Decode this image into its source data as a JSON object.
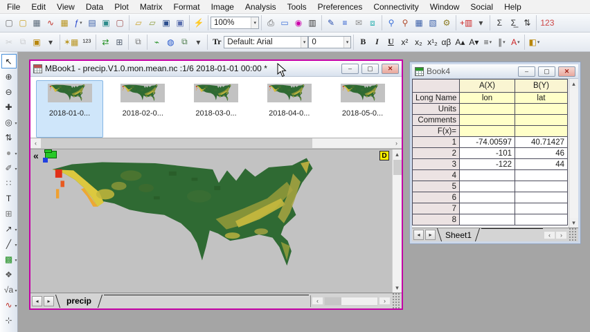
{
  "menu": {
    "items": [
      "File",
      "Edit",
      "View",
      "Data",
      "Plot",
      "Matrix",
      "Format",
      "Image",
      "Analysis",
      "Tools",
      "Preferences",
      "Connectivity",
      "Window",
      "Social",
      "Help"
    ]
  },
  "glyphs": {
    "min": "‒",
    "restore": "▢",
    "close": "✕",
    "left": "◂",
    "right": "▸",
    "sleft": "‹",
    "sright": "›",
    "up": "▴",
    "down": "▾"
  },
  "tb1": {
    "g1": [
      {
        "n": "new-project-button",
        "g": "▢",
        "c": "#6a6a6a"
      },
      {
        "n": "new-folder-button",
        "g": "▢",
        "c": "#c9a227"
      },
      {
        "n": "new-workbook-button",
        "g": "▦",
        "c": "#5a6a7a"
      },
      {
        "n": "new-graph-button",
        "g": "∿",
        "c": "#c03028"
      },
      {
        "n": "new-matrix-button",
        "g": "▦",
        "c": "#b8941f"
      },
      {
        "n": "new-function-button",
        "g": "ƒ",
        "c": "#2244cc",
        "dd": 1
      },
      {
        "n": "new-report-button",
        "g": "▤",
        "c": "#3a5fa8"
      },
      {
        "n": "new-layout-button",
        "g": "▣",
        "c": "#2e8b8b"
      },
      {
        "n": "new-notes-button",
        "g": "▢",
        "c": "#a05050"
      }
    ],
    "g2": [
      {
        "n": "open-button",
        "g": "▱",
        "c": "#c9a227"
      },
      {
        "n": "open-template-button",
        "g": "▱",
        "c": "#8a9a3a"
      },
      {
        "n": "save-project-button",
        "g": "▣",
        "c": "#2d4f8e"
      },
      {
        "n": "save-template-button",
        "g": "▣",
        "c": "#5a6fae"
      }
    ],
    "g3": [
      {
        "n": "import-wizard-run-button",
        "g": "⚡",
        "c": "#1e9e1e"
      }
    ],
    "zoom": {
      "value": "100%"
    },
    "g5": [
      {
        "n": "print-button",
        "g": "⎙",
        "c": "#555555"
      },
      {
        "n": "slide-view-button",
        "g": "▭",
        "c": "#3a6fd8"
      },
      {
        "n": "active-frame-button",
        "g": "◉",
        "c": "#cc00aa"
      },
      {
        "n": "video-button",
        "g": "▥",
        "c": "#333333"
      }
    ],
    "g6": [
      {
        "n": "edit-page-button",
        "g": "✎",
        "c": "#2a4fae"
      },
      {
        "n": "arrange-layers-button",
        "g": "≡",
        "c": "#2255cc"
      },
      {
        "n": "send-graph-button",
        "g": "✉",
        "c": "#8a8a8a"
      },
      {
        "n": "project-explorer-button",
        "g": "⧈",
        "c": "#2ab0b0"
      }
    ],
    "g7": [
      {
        "n": "zoom-window-button",
        "g": "⚲",
        "c": "#3a6fd8"
      },
      {
        "n": "find-button",
        "g": "⚲",
        "c": "#b04a2a"
      },
      {
        "n": "worksheet-view-button",
        "g": "▦",
        "c": "#3a5fa8"
      },
      {
        "n": "format-worksheet-button",
        "g": "▧",
        "c": "#3a5fa8"
      },
      {
        "n": "options-button",
        "g": "⚙",
        "c": "#8a7a20"
      }
    ],
    "g8": [
      {
        "n": "add-column-button",
        "g": "+▥",
        "c": "#cc2222"
      },
      {
        "n": "toolbar-overflow-button",
        "g": "▾",
        "c": "#444444"
      }
    ],
    "g9": [
      {
        "n": "sum-column-button",
        "g": "Σ",
        "c": "#333333"
      },
      {
        "n": "statistics-button",
        "g": "Σ̲",
        "c": "#333333"
      },
      {
        "n": "sort-button",
        "g": "⇅",
        "c": "#333333"
      }
    ],
    "g10": [
      {
        "n": "set-values-button",
        "g": "123",
        "c": "#cc4444"
      }
    ]
  },
  "tb2": {
    "h1": [
      {
        "n": "cut-button",
        "g": "✂",
        "c": "#999999",
        "dim": 1
      },
      {
        "n": "copy-button",
        "g": "⧉",
        "c": "#999999",
        "dim": 1
      },
      {
        "n": "paste-button",
        "g": "▣",
        "c": "#b8860b"
      },
      {
        "n": "clipboard-overflow-button",
        "g": "▾",
        "c": "#444444"
      }
    ],
    "h2": [
      {
        "n": "import-wizard-button",
        "g": "✶▦",
        "c": "#b8941f"
      },
      {
        "n": "import-ascii-button",
        "g": "¹²³",
        "c": "#333333"
      }
    ],
    "h3": [
      {
        "n": "reimport-button",
        "g": "⇄",
        "c": "#1e8e1e"
      },
      {
        "n": "reimport-direct-button",
        "g": "⊞",
        "c": "#556070"
      }
    ],
    "h4": [
      {
        "n": "clone-import-button",
        "g": "⧉",
        "c": "#777777"
      }
    ],
    "h5": [
      {
        "n": "data-connector-button",
        "g": "⌁",
        "c": "#1e8e1e"
      },
      {
        "n": "web-connector-button",
        "g": "◍",
        "c": "#2255cc"
      },
      {
        "n": "connector-clone-button",
        "g": "⧉",
        "c": "#4a7a4a"
      },
      {
        "n": "import-overflow-button",
        "g": "▾",
        "c": "#444444"
      }
    ],
    "font": {
      "tr_label": "Tr",
      "family": "Default: Arial",
      "size": "0"
    },
    "h7": [
      {
        "n": "bold-button",
        "g": "B",
        "c": "#222222"
      },
      {
        "n": "italic-button",
        "g": "I",
        "c": "#222222"
      },
      {
        "n": "underline-button",
        "g": "U",
        "c": "#222222"
      },
      {
        "n": "superscript-button",
        "g": "x²",
        "c": "#222222"
      },
      {
        "n": "subscript-button",
        "g": "x₂",
        "c": "#222222"
      },
      {
        "n": "supersubscript-button",
        "g": "x¹₂",
        "c": "#222222"
      },
      {
        "n": "greek-button",
        "g": "αβ",
        "c": "#222222"
      },
      {
        "n": "increase-font-button",
        "g": "A▴",
        "c": "#222222"
      },
      {
        "n": "decrease-font-button",
        "g": "A▾",
        "c": "#222222"
      },
      {
        "n": "align-button",
        "g": "≡",
        "c": "#444444",
        "dd": 1
      },
      {
        "n": "distribute-button",
        "g": "∥",
        "c": "#444444",
        "dd": 1
      },
      {
        "n": "font-color-button",
        "g": "A",
        "c": "#cc2222",
        "dd": 1
      }
    ],
    "h8": [
      {
        "n": "fill-color-button",
        "g": "◧",
        "c": "#b8860b",
        "dd": 1
      }
    ]
  },
  "sidebar": {
    "tools": [
      {
        "n": "pointer-tool",
        "g": "↖",
        "c": "#111111",
        "sel": 1
      },
      {
        "n": "zoom-in-tool",
        "g": "⊕",
        "c": "#333333"
      },
      {
        "n": "zoom-out-tool",
        "g": "⊖",
        "c": "#333333"
      },
      {
        "n": "screen-reader-tool",
        "g": "✚",
        "c": "#333333"
      },
      {
        "n": "data-reader-tool",
        "g": "◎",
        "c": "#333333",
        "dd": 1
      },
      {
        "n": "data-selector-tool",
        "g": "⇅",
        "c": "#333333"
      },
      {
        "n": "mask-tool",
        "g": "●",
        "c": "#999999",
        "dd": 1
      },
      {
        "n": "draw-data-tool",
        "g": "✐",
        "c": "#555555",
        "dd": 1
      },
      {
        "n": "regional-select-tool",
        "g": "∷",
        "c": "#666666"
      },
      {
        "n": "text-tool",
        "g": "T",
        "c": "#222222"
      },
      {
        "n": "annotation-tool",
        "g": "⊞",
        "c": "#777777"
      },
      {
        "n": "arrow-tool",
        "g": "↗",
        "c": "#333333",
        "dd": 1
      },
      {
        "n": "line-tool",
        "g": "╱",
        "c": "#333333",
        "dd": 1
      },
      {
        "n": "polygon-tool",
        "g": "▩",
        "c": "#1e8e1e",
        "dd": 1
      },
      {
        "n": "pan-tool",
        "g": "❖",
        "c": "#555555"
      },
      {
        "n": "equation-tool",
        "g": "√a",
        "c": "#555555",
        "dd": 1
      },
      {
        "n": "insert-graph-tool",
        "g": "∿",
        "c": "#c03028",
        "dd": 1
      },
      {
        "n": "rescale-tool",
        "g": "⊹",
        "c": "#555555"
      }
    ]
  },
  "mbook": {
    "title": "MBook1 - precip.V1.0.mon.mean.nc :1/6 2018-01-01 00:00 *",
    "collapse_glyph": "«",
    "connector_badge": "D",
    "tab": "precip",
    "thumbnails": [
      {
        "label": "2018-01-0...",
        "sel": 1
      },
      {
        "label": "2018-02-0..."
      },
      {
        "label": "2018-03-0..."
      },
      {
        "label": "2018-04-0..."
      },
      {
        "label": "2018-05-0..."
      }
    ]
  },
  "book4": {
    "title": "Book4",
    "tab": "Sheet1",
    "columns": {
      "a": "A(X)",
      "b": "B(Y)"
    },
    "rows": [
      {
        "label": "Long Name",
        "a": "lon",
        "b": "lat",
        "hdr": 1
      },
      {
        "label": "Units",
        "hdr": 1
      },
      {
        "label": "Comments",
        "hdr": 1
      },
      {
        "label": "F(x)=",
        "hdr": 1
      },
      {
        "label": "1",
        "a": "-74.00597",
        "b": "40.71427"
      },
      {
        "label": "2",
        "a": "-101",
        "b": "46"
      },
      {
        "label": "3",
        "a": "-122",
        "b": "44"
      },
      {
        "label": "4"
      },
      {
        "label": "5"
      },
      {
        "label": "6"
      },
      {
        "label": "7"
      },
      {
        "label": "8"
      }
    ]
  },
  "colors": {
    "active_window_border": "#c400a6",
    "selected_thumb": "#cfe6fa",
    "header_yellow": "#ffffc8",
    "row_label_pink": "#ece3e3",
    "map_background": "#c2c2c2",
    "map_green": "#2f6a33",
    "map_yellow": "#dcc83e",
    "map_red": "#e03018",
    "connector_badge_yellow": "#ffee00"
  }
}
